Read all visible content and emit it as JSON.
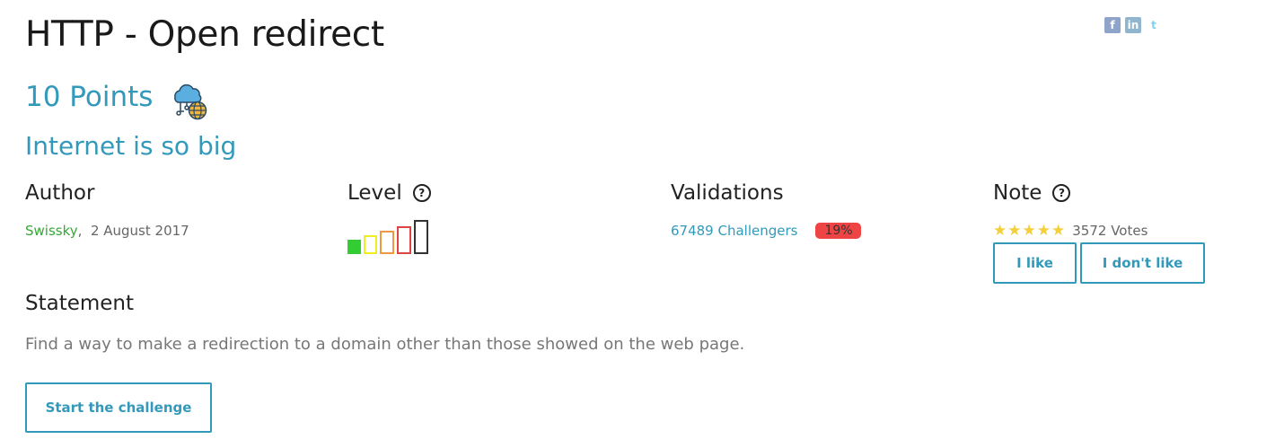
{
  "challenge": {
    "title": "HTTP - Open redirect",
    "points": "10 Points",
    "subtitle": "Internet is so big",
    "category_icon": "cloud-network-globe-icon"
  },
  "social": {
    "icons": [
      "facebook-icon",
      "linkedin-icon",
      "twitter-icon"
    ],
    "facebook_glyph": "f",
    "linkedin_glyph": "in",
    "twitter_glyph": "t"
  },
  "author": {
    "heading": "Author",
    "name": "Swissky",
    "separator": ",",
    "date": "2 August 2017"
  },
  "level": {
    "heading": "Level",
    "help_glyph": "?",
    "levels_total": 5,
    "current_level": 1,
    "colors": [
      "#33cc33",
      "#eeee22",
      "#ee9944",
      "#dd4444",
      "#333333"
    ]
  },
  "validations": {
    "heading": "Validations",
    "challengers": "67489 Challengers",
    "percent": "19%",
    "badge_color": "#ee4444"
  },
  "note": {
    "heading": "Note",
    "help_glyph": "?",
    "stars": 5,
    "star_glyph": "★",
    "votes": "3572 Votes",
    "like_label": "I like",
    "dislike_label": "I don't like"
  },
  "statement": {
    "heading": "Statement",
    "text": "Find a way to make a redirection to a domain other than those showed on the web page."
  },
  "actions": {
    "start_label": "Start the challenge"
  },
  "theme": {
    "accent": "#3399bb",
    "author_link": "#33aa33",
    "star": "#f3cf3a"
  }
}
